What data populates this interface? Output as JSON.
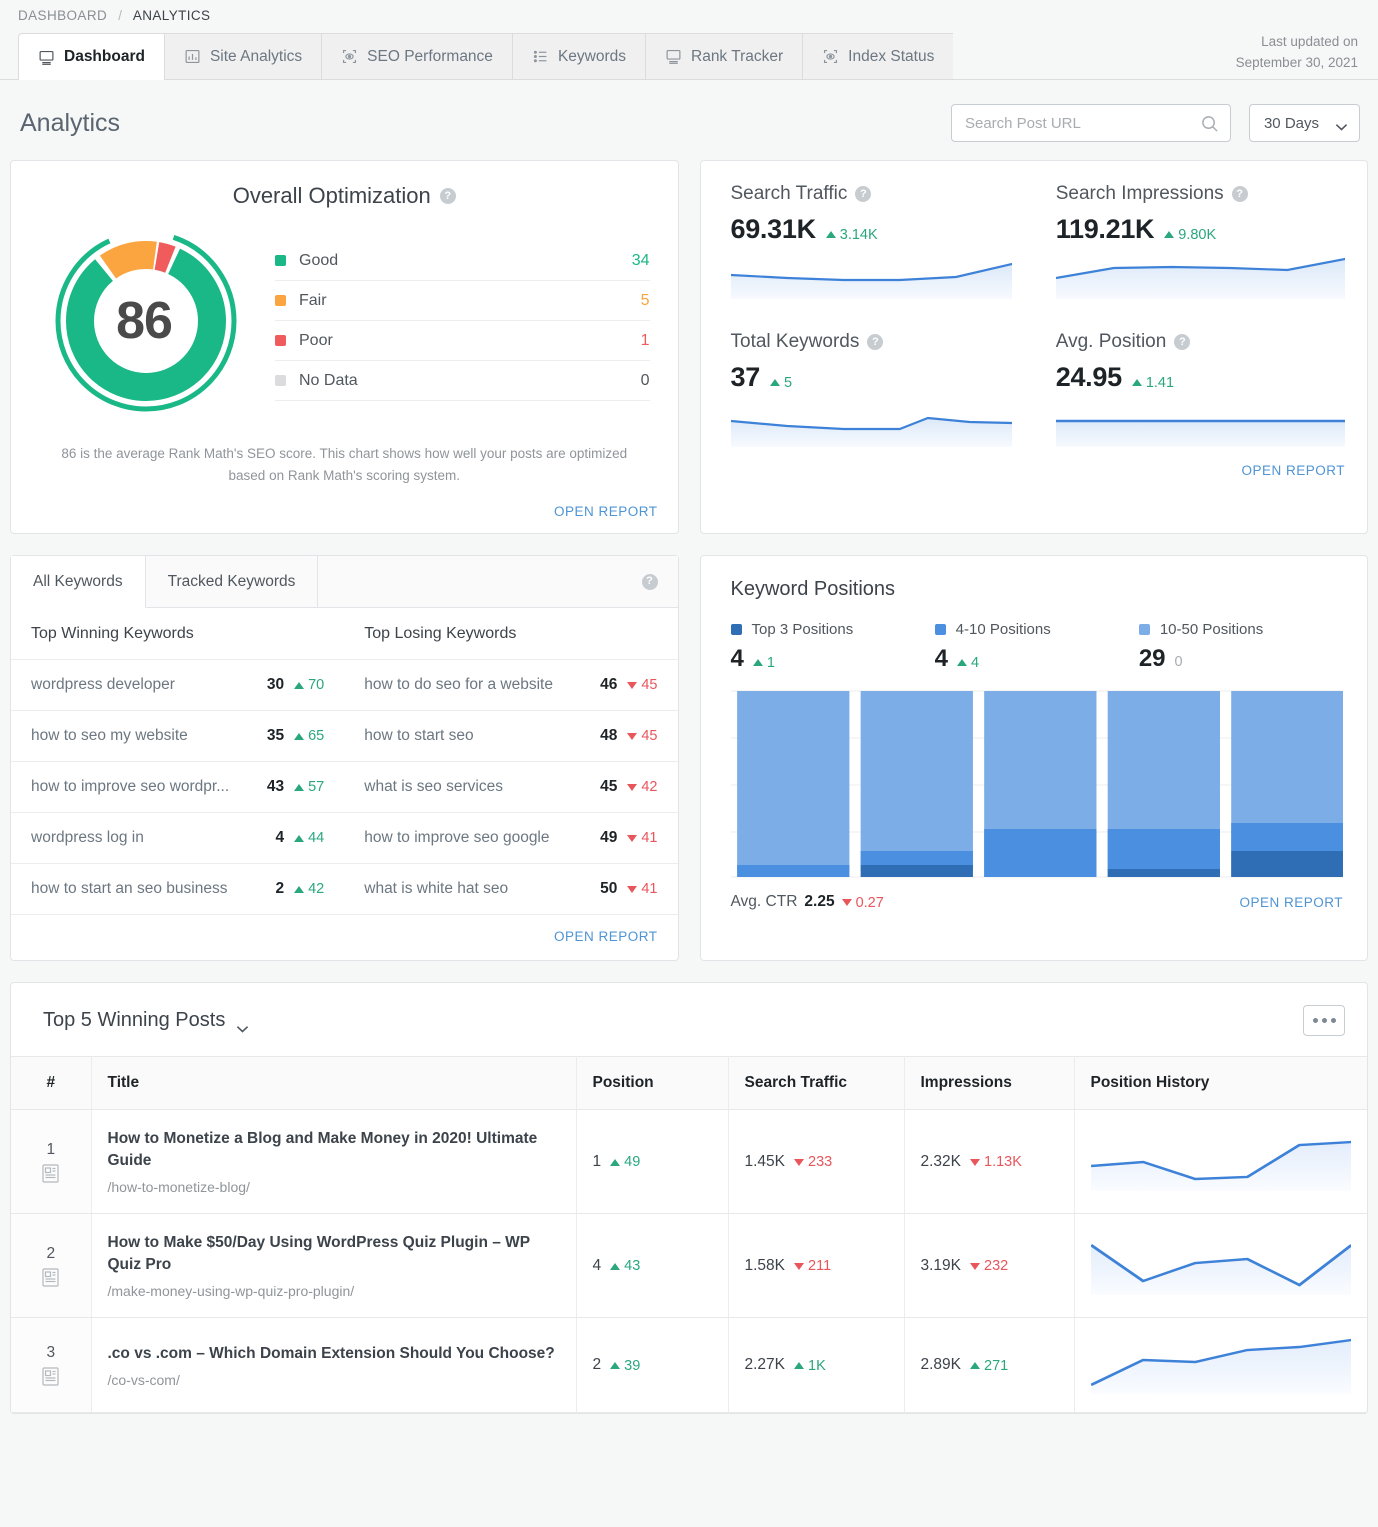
{
  "breadcrumb": {
    "parent": "DASHBOARD",
    "separator": "/",
    "current": "ANALYTICS"
  },
  "tabs": [
    {
      "label": "Dashboard",
      "icon": "monitor-icon",
      "active": true
    },
    {
      "label": "Site Analytics",
      "icon": "bar-chart-icon",
      "active": false
    },
    {
      "label": "SEO Performance",
      "icon": "eye-frame-icon",
      "active": false
    },
    {
      "label": "Keywords",
      "icon": "list-icon",
      "active": false
    },
    {
      "label": "Rank Tracker",
      "icon": "monitor-icon",
      "active": false
    },
    {
      "label": "Index Status",
      "icon": "eye-frame-icon",
      "active": false
    }
  ],
  "last_updated": {
    "line1": "Last updated on",
    "line2": "September 30, 2021"
  },
  "page": {
    "title": "Analytics"
  },
  "search": {
    "placeholder": "Search Post URL",
    "value": "",
    "icon": "search-icon"
  },
  "date_range": {
    "selected": "30 Days",
    "icon": "chevron-down-icon"
  },
  "optimization": {
    "title": "Overall Optimization",
    "help_icon": "help-icon",
    "score": "86",
    "description": "86 is the average Rank Math's SEO score. This chart shows how well your posts are optimized based on Rank Math's scoring system.",
    "open_report": "OPEN REPORT",
    "legend": [
      {
        "label": "Good",
        "value": "34",
        "color": "#19b886"
      },
      {
        "label": "Fair",
        "value": "5",
        "color": "#faa53f"
      },
      {
        "label": "Poor",
        "value": "1",
        "color": "#f05c5c"
      },
      {
        "label": "No Data",
        "value": "0",
        "color": "#dcdcde"
      }
    ]
  },
  "stats": {
    "open_report": "OPEN REPORT",
    "items": [
      {
        "label": "Search Traffic",
        "value": "69.31K",
        "delta": "3.14K",
        "direction": "up",
        "help_icon": "help-icon"
      },
      {
        "label": "Search Impressions",
        "value": "119.21K",
        "delta": "9.80K",
        "direction": "up",
        "help_icon": "help-icon"
      },
      {
        "label": "Total Keywords",
        "value": "37",
        "delta": "5",
        "direction": "up",
        "help_icon": "help-icon"
      },
      {
        "label": "Avg. Position",
        "value": "24.95",
        "delta": "1.41",
        "direction": "up",
        "help_icon": "help-icon"
      }
    ]
  },
  "keywords": {
    "tabs": [
      {
        "label": "All Keywords",
        "active": true
      },
      {
        "label": "Tracked Keywords",
        "active": false
      }
    ],
    "help_icon": "help-icon",
    "col_winning": "Top Winning Keywords",
    "col_losing": "Top Losing Keywords",
    "open_report": "OPEN REPORT",
    "winning": [
      {
        "name": "wordpress developer",
        "position": "30",
        "delta": "70",
        "direction": "up"
      },
      {
        "name": "how to seo my website",
        "position": "35",
        "delta": "65",
        "direction": "up"
      },
      {
        "name": "how to improve seo wordpr...",
        "position": "43",
        "delta": "57",
        "direction": "up"
      },
      {
        "name": "wordpress log in",
        "position": "4",
        "delta": "44",
        "direction": "up"
      },
      {
        "name": "how to start an seo business",
        "position": "2",
        "delta": "42",
        "direction": "up"
      }
    ],
    "losing": [
      {
        "name": "how to do seo for a website",
        "position": "46",
        "delta": "45",
        "direction": "down"
      },
      {
        "name": "how to start seo",
        "position": "48",
        "delta": "45",
        "direction": "down"
      },
      {
        "name": "what is seo services",
        "position": "45",
        "delta": "42",
        "direction": "down"
      },
      {
        "name": "how to improve seo google",
        "position": "49",
        "delta": "41",
        "direction": "down"
      },
      {
        "name": "what is white hat seo",
        "position": "50",
        "delta": "41",
        "direction": "down"
      }
    ]
  },
  "keyword_positions": {
    "title": "Keyword Positions",
    "open_report": "OPEN REPORT",
    "ctr_label": "Avg. CTR",
    "ctr_value": "2.25",
    "ctr_delta": "0.27",
    "ctr_direction": "down",
    "legend": [
      {
        "label": "Top 3 Positions",
        "value": "4",
        "delta": "1",
        "direction": "up",
        "color": "#2f6db5"
      },
      {
        "label": "4-10 Positions",
        "value": "4",
        "delta": "4",
        "direction": "up",
        "color": "#4a8fe0"
      },
      {
        "label": "10-50 Positions",
        "value": "29",
        "delta": "0",
        "direction": "none",
        "color": "#7cade6"
      }
    ]
  },
  "posts": {
    "title": "Top 5 Winning Posts",
    "title_icon": "chevron-down-icon",
    "menu_icon": "ellipsis-icon",
    "columns": [
      "#",
      "Title",
      "Position",
      "Search Traffic",
      "Impressions",
      "Position History"
    ],
    "rows": [
      {
        "num": "1",
        "title": "How to Monetize a Blog and Make Money in 2020! Ultimate Guide",
        "url": "/how-to-monetize-blog/",
        "position": "1",
        "position_delta": "49",
        "position_dir": "up",
        "traffic": "1.45K",
        "traffic_delta": "233",
        "traffic_dir": "down",
        "impressions": "2.32K",
        "impressions_delta": "1.13K",
        "impressions_dir": "down"
      },
      {
        "num": "2",
        "title": "How to Make $50/Day Using WordPress Quiz Plugin – WP Quiz Pro",
        "url": "/make-money-using-wp-quiz-pro-plugin/",
        "position": "4",
        "position_delta": "43",
        "position_dir": "up",
        "traffic": "1.58K",
        "traffic_delta": "211",
        "traffic_dir": "down",
        "impressions": "3.19K",
        "impressions_delta": "232",
        "impressions_dir": "down"
      },
      {
        "num": "3",
        "title": ".co vs .com – Which Domain Extension Should You Choose?",
        "url": "/co-vs-com/",
        "position": "2",
        "position_delta": "39",
        "position_dir": "up",
        "traffic": "2.27K",
        "traffic_delta": "1K",
        "traffic_dir": "up",
        "impressions": "2.89K",
        "impressions_delta": "271",
        "impressions_dir": "up"
      }
    ]
  },
  "chart_data": [
    {
      "type": "pie",
      "title": "Overall Optimization",
      "categories": [
        "Good",
        "Fair",
        "Poor",
        "No Data"
      ],
      "values": [
        34,
        5,
        1,
        0
      ],
      "colors": [
        "#19b886",
        "#faa53f",
        "#f05c5c",
        "#dcdcde"
      ],
      "center_label": "86",
      "legend": "right"
    },
    {
      "type": "area",
      "title": "Search Traffic",
      "x": [
        1,
        2,
        3,
        4,
        5,
        6
      ],
      "values": [
        50,
        46,
        44,
        44,
        47,
        62
      ],
      "ylabel": "",
      "xlabel": "",
      "grid": false,
      "color": "#3d82d8"
    },
    {
      "type": "area",
      "title": "Search Impressions",
      "x": [
        1,
        2,
        3,
        4,
        5,
        6
      ],
      "values": [
        44,
        56,
        57,
        56,
        53,
        66
      ],
      "ylabel": "",
      "xlabel": "",
      "grid": false,
      "color": "#3d82d8"
    },
    {
      "type": "area",
      "title": "Total Keywords",
      "x": [
        1,
        2,
        3,
        4,
        5,
        6
      ],
      "values": [
        55,
        45,
        40,
        40,
        62,
        52
      ],
      "ylabel": "",
      "xlabel": "",
      "grid": false,
      "color": "#3d82d8"
    },
    {
      "type": "area",
      "title": "Avg. Position",
      "x": [
        1,
        2,
        3,
        4,
        5,
        6
      ],
      "values": [
        30,
        30,
        30,
        30,
        30,
        30
      ],
      "ylabel": "",
      "xlabel": "",
      "grid": false,
      "color": "#3d82d8"
    },
    {
      "type": "bar",
      "title": "Keyword Positions",
      "stacked": true,
      "categories": [
        "1",
        "2",
        "3",
        "4",
        "5"
      ],
      "series": [
        {
          "name": "Top 3 Positions",
          "values": [
            0,
            4,
            0,
            2,
            8
          ],
          "color": "#2f6db5"
        },
        {
          "name": "4-10 Positions",
          "values": [
            3,
            4,
            16,
            14,
            10
          ],
          "color": "#4a8fe0"
        },
        {
          "name": "10-50 Positions",
          "values": [
            97,
            92,
            84,
            84,
            82
          ],
          "color": "#7cade6"
        }
      ],
      "ylim": [
        0,
        100
      ],
      "grid": true,
      "legend": "top"
    },
    {
      "type": "line",
      "title": "Position History - How to Monetize a Blog and Make Money in 2020! Ultimate Guide",
      "x": [
        1,
        2,
        3,
        4,
        5,
        6
      ],
      "values": [
        40,
        48,
        18,
        22,
        76,
        82
      ],
      "grid": false,
      "color": "#3d82d8"
    },
    {
      "type": "line",
      "title": "Position History - How to Make $50/Day Using WordPress Quiz Plugin – WP Quiz Pro",
      "x": [
        1,
        2,
        3,
        4,
        5,
        6
      ],
      "values": [
        88,
        30,
        62,
        68,
        20,
        88
      ],
      "grid": false,
      "color": "#3d82d8"
    },
    {
      "type": "line",
      "title": "Position History - .co vs .com – Which Domain Extension Should You Choose?",
      "x": [
        1,
        2,
        3,
        4,
        5,
        6
      ],
      "values": [
        8,
        52,
        48,
        68,
        74,
        92
      ],
      "grid": false,
      "color": "#3d82d8"
    }
  ]
}
